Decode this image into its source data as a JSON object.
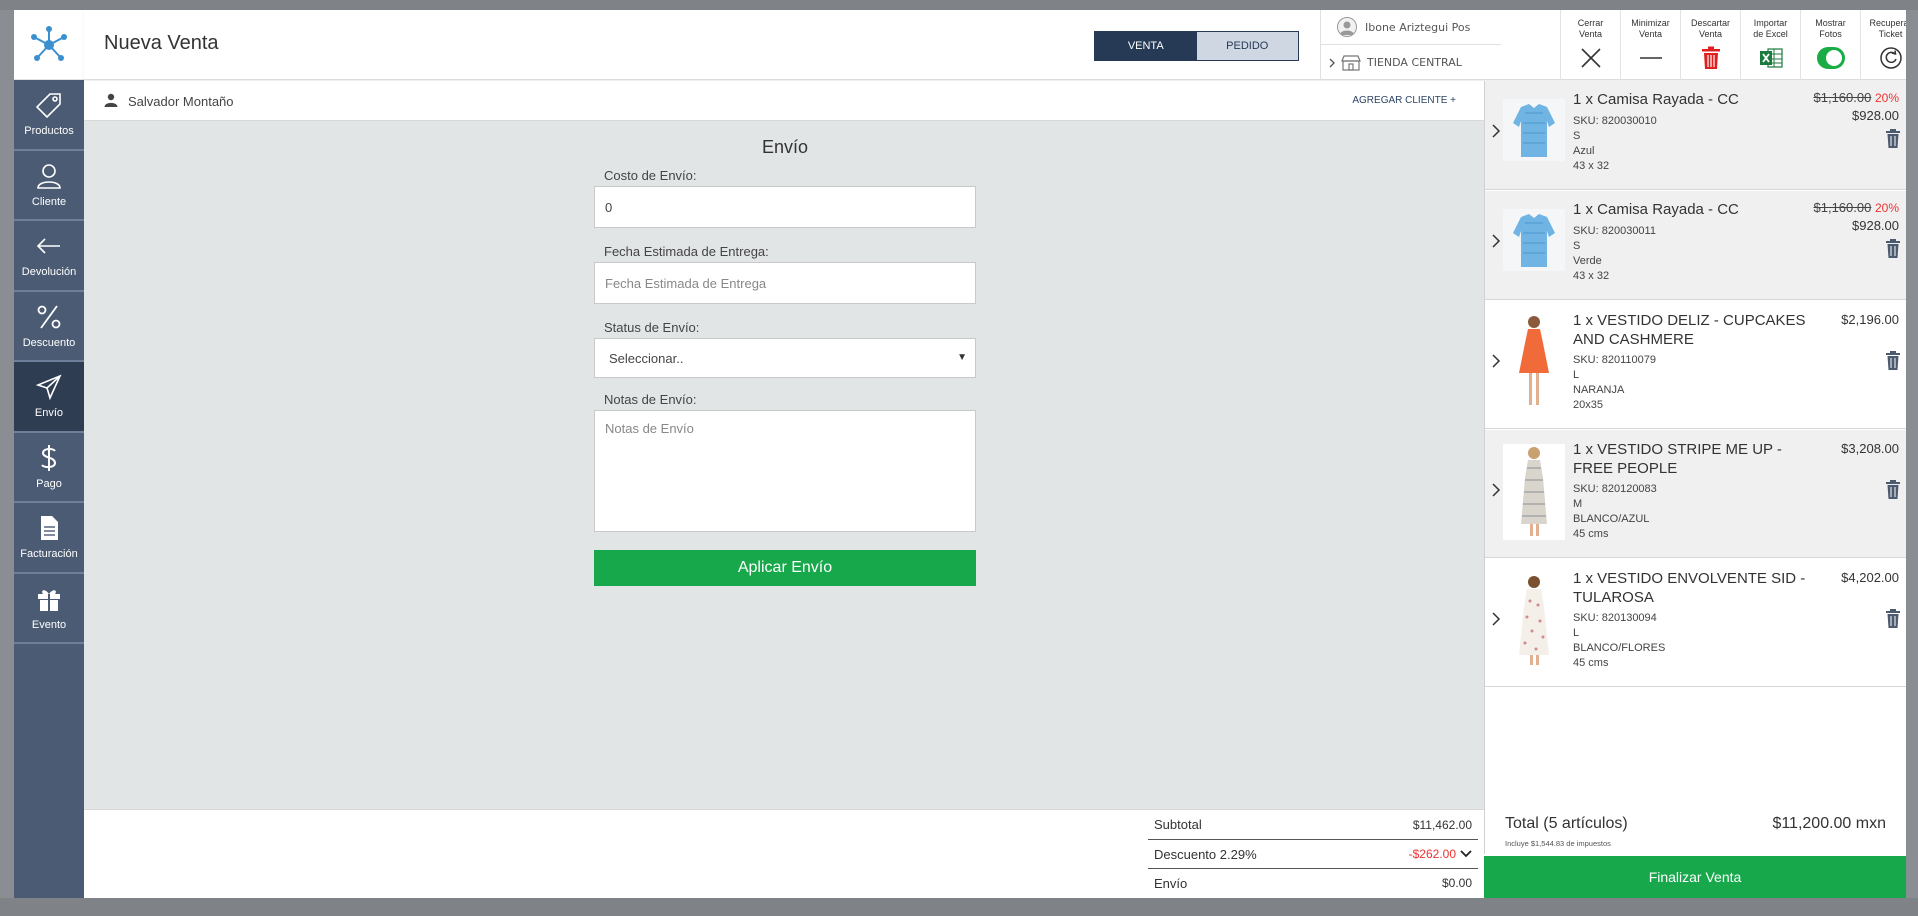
{
  "header": {
    "title": "Nueva Venta",
    "mode_sale": "VENTA",
    "mode_order": "PEDIDO",
    "user": "Ibone Ariztegui Pos",
    "store": "TIENDA CENTRAL"
  },
  "tools": [
    {
      "label": "Cerrar\nVenta",
      "icon": "close-icon"
    },
    {
      "label": "Minimizar\nVenta",
      "icon": "minus-icon"
    },
    {
      "label": "Descartar\nVenta",
      "icon": "trash-icon"
    },
    {
      "label": "Importar\nde Excel",
      "icon": "excel-icon"
    },
    {
      "label": "Mostrar\nFotos",
      "icon": "toggle-switch"
    },
    {
      "label": "Recuperar\nTicket",
      "icon": "refresh-icon"
    }
  ],
  "sidebar": {
    "items": [
      {
        "label": "Productos",
        "icon": "tag-icon"
      },
      {
        "label": "Cliente",
        "icon": "user-icon"
      },
      {
        "label": "Devolución",
        "icon": "arrow-left-icon"
      },
      {
        "label": "Descuento",
        "icon": "percent-icon"
      },
      {
        "label": "Envío",
        "icon": "send-icon"
      },
      {
        "label": "Pago",
        "icon": "dollar-icon"
      },
      {
        "label": "Facturación",
        "icon": "document-icon"
      },
      {
        "label": "Evento",
        "icon": "gift-icon"
      }
    ]
  },
  "customer": {
    "name": "Salvador Montaño",
    "add_label": "AGREGAR CLIENTE +"
  },
  "shipping": {
    "title": "Envío",
    "cost_label": "Costo de Envío:",
    "cost_value": "0",
    "date_label": "Fecha Estimada de Entrega:",
    "date_placeholder": "Fecha Estimada de Entrega",
    "status_label": "Status de Envío:",
    "status_value": "Seleccionar..",
    "notes_label": "Notas de Envío:",
    "notes_placeholder": "Notas de Envío",
    "apply_label": "Aplicar Envío"
  },
  "totals": {
    "subtotal_label": "Subtotal",
    "subtotal_value": "$11,462.00",
    "discount_label": "Descuento 2.29%",
    "discount_value": "-$262.00",
    "shipping_label": "Envío",
    "shipping_value": "$0.00"
  },
  "cart": {
    "items": [
      {
        "title": "1 x Camisa Rayada - CC",
        "sku": "SKU: 820030010",
        "size": "S",
        "color": "Azul",
        "dims": "43 x 32",
        "old_price": "$1,160.00",
        "discount": "20%",
        "price": "$928.00"
      },
      {
        "title": "1 x Camisa Rayada - CC",
        "sku": "SKU: 820030011",
        "size": "S",
        "color": "Verde",
        "dims": "43 x 32",
        "old_price": "$1,160.00",
        "discount": "20%",
        "price": "$928.00"
      },
      {
        "title": "1 x VESTIDO DELIZ - CUPCAKES AND CASHMERE",
        "sku": "SKU: 820110079",
        "size": "L",
        "color": "NARANJA",
        "dims": "20x35",
        "price": "$2,196.00"
      },
      {
        "title": "1 x VESTIDO STRIPE ME UP - FREE PEOPLE",
        "sku": "SKU: 820120083",
        "size": "M",
        "color": "BLANCO/AZUL",
        "dims": "45 cms",
        "price": "$3,208.00"
      },
      {
        "title": "1 x VESTIDO ENVOLVENTE SID - TULAROSA",
        "sku": "SKU: 820130094",
        "size": "L",
        "color": "BLANCO/FLORES",
        "dims": "45 cms",
        "price": "$4,202.00"
      }
    ],
    "total_label": "Total (5 artículos)",
    "total_value": "$11,200.00 mxn",
    "tax_note": "Incluye $1,544.83 de impuestos",
    "finalize_label": "Finalizar Venta"
  },
  "colors": {
    "sidebar": "#4a5b73",
    "sidebar_active": "#2e3d52",
    "accent_green": "#16a84a",
    "navy": "#263a55",
    "red": "#e33333"
  }
}
